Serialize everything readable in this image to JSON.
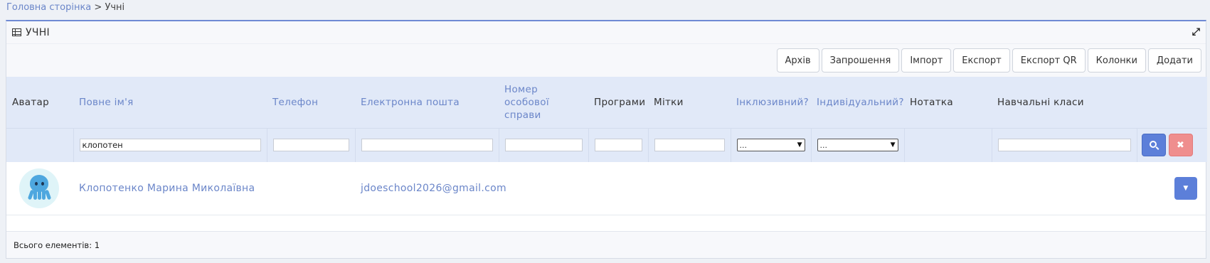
{
  "breadcrumb": {
    "home": "Головна сторінка",
    "separator": ">",
    "current": "Учні"
  },
  "panel": {
    "title": "УЧНІ",
    "title_icon": "table-icon",
    "expand_icon": "expand-arrows-icon"
  },
  "toolbar": {
    "buttons": [
      "Архів",
      "Запрошення",
      "Імпорт",
      "Експорт",
      "Експорт QR",
      "Колонки",
      "Додати"
    ]
  },
  "table": {
    "headers": {
      "avatar": "Аватар",
      "full_name": "Повне ім'я",
      "phone": "Телефон",
      "email": "Електронна пошта",
      "file_number_l1": "Номер",
      "file_number_l2": "особової",
      "file_number_l3": "справи",
      "programs": "Програми",
      "tags": "Мітки",
      "inclusive": "Інклюзивний?",
      "individual": "Індивідуальний?",
      "note": "Нотатка",
      "classes": "Навчальні класи"
    },
    "filters": {
      "full_name": "клопотен",
      "phone": "",
      "email": "",
      "file_number": "",
      "programs": "",
      "tags": "",
      "inclusive": "...",
      "individual": "...",
      "classes": ""
    },
    "rows": [
      {
        "avatar_icon": "octopus-avatar-icon",
        "full_name": "Клопотенко Марина Миколаївна",
        "phone": "",
        "email": "jdoeschool2026@gmail.com"
      }
    ]
  },
  "footer": {
    "total_label": "Всього елементів: 1"
  },
  "colors": {
    "accent": "#5c7fd9",
    "link": "#6b86c9",
    "header_bg": "#e1e9f8",
    "danger": "#ef8e8e"
  }
}
